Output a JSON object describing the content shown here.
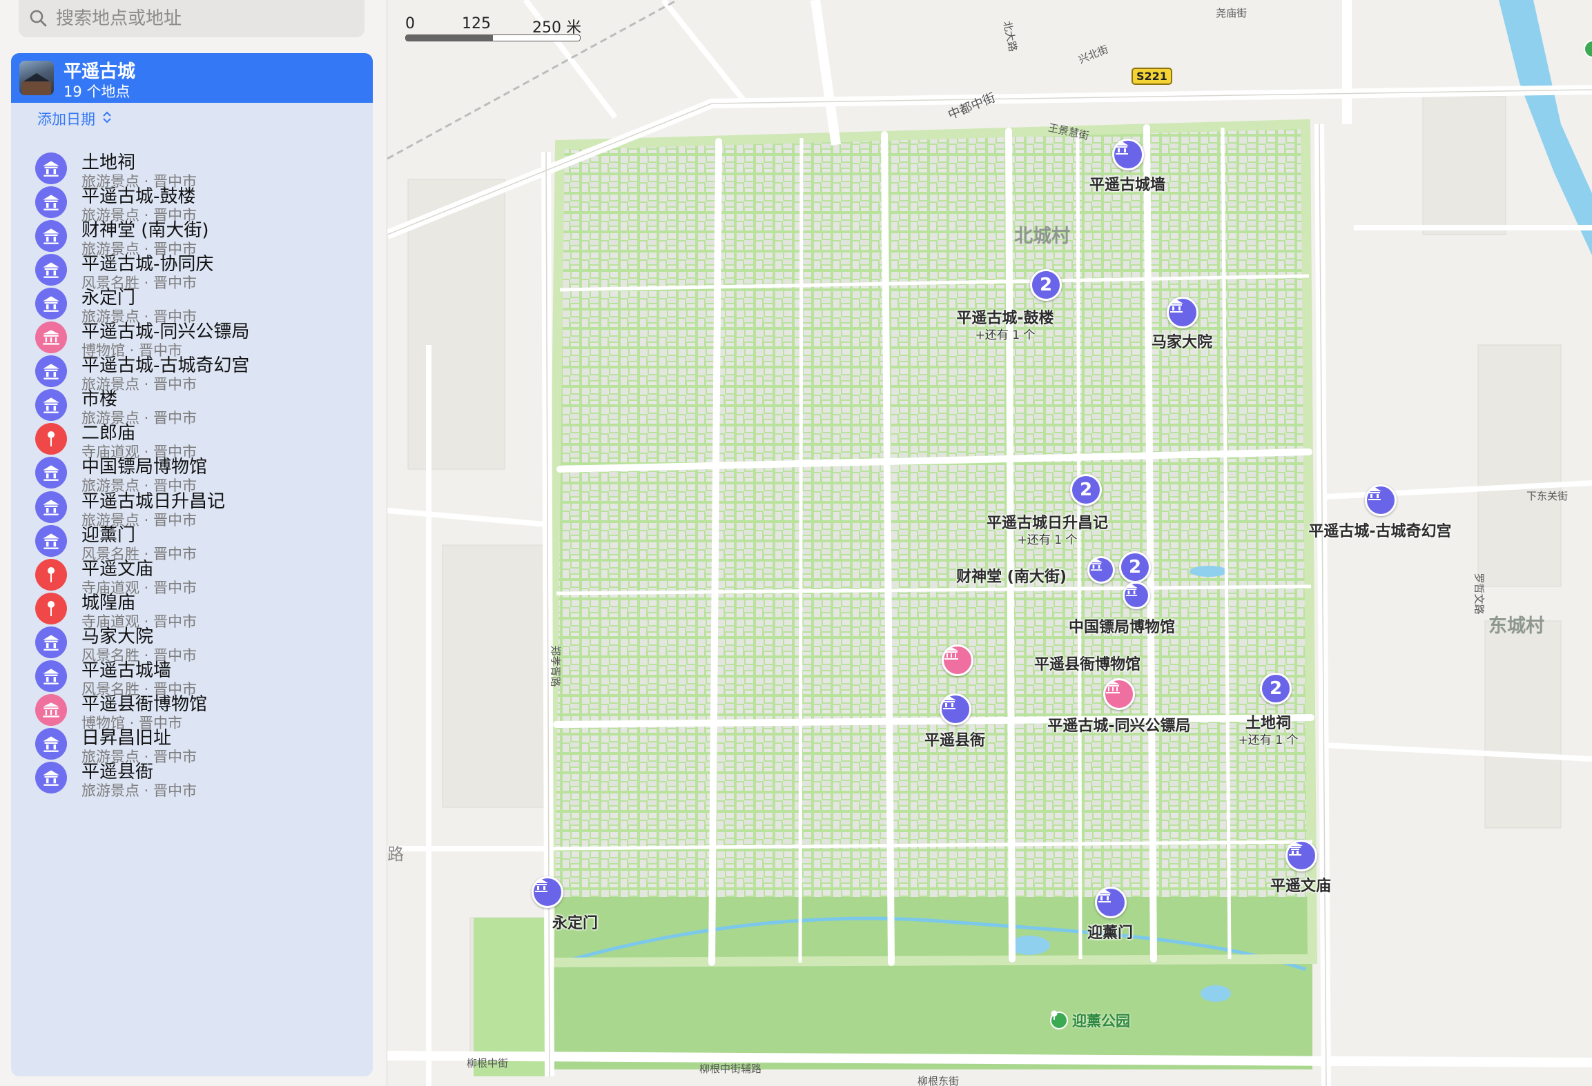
{
  "search": {
    "placeholder": "搜索地点或地址"
  },
  "guide": {
    "title": "平遥古城",
    "count": "19 个地点",
    "add_date": "添加日期",
    "places": [
      {
        "name": "土地祠",
        "category": "旅游景点",
        "city": "晋中市",
        "icon": "landmark-icon",
        "color": "purple"
      },
      {
        "name": "平遥古城-鼓楼",
        "category": "旅游景点",
        "city": "晋中市",
        "icon": "landmark-icon",
        "color": "purple"
      },
      {
        "name": "财神堂 (南大街)",
        "category": "旅游景点",
        "city": "晋中市",
        "icon": "landmark-icon",
        "color": "purple"
      },
      {
        "name": "平遥古城-协同庆",
        "category": "风景名胜",
        "city": "晋中市",
        "icon": "landmark-icon",
        "color": "purple"
      },
      {
        "name": "永定门",
        "category": "旅游景点",
        "city": "晋中市",
        "icon": "landmark-icon",
        "color": "purple"
      },
      {
        "name": "平遥古城-同兴公镖局",
        "category": "博物馆",
        "city": "晋中市",
        "icon": "museum-icon",
        "color": "pink"
      },
      {
        "name": "平遥古城-古城奇幻宫",
        "category": "旅游景点",
        "city": "晋中市",
        "icon": "landmark-icon",
        "color": "purple"
      },
      {
        "name": "市楼",
        "category": "旅游景点",
        "city": "晋中市",
        "icon": "landmark-icon",
        "color": "purple"
      },
      {
        "name": "二郎庙",
        "category": "寺庙道观",
        "city": "晋中市",
        "icon": "pin-icon",
        "color": "red"
      },
      {
        "name": "中国镖局博物馆",
        "category": "旅游景点",
        "city": "晋中市",
        "icon": "landmark-icon",
        "color": "purple"
      },
      {
        "name": "平遥古城日升昌记",
        "category": "旅游景点",
        "city": "晋中市",
        "icon": "landmark-icon",
        "color": "purple"
      },
      {
        "name": "迎薰门",
        "category": "风景名胜",
        "city": "晋中市",
        "icon": "landmark-icon",
        "color": "purple"
      },
      {
        "name": "平遥文庙",
        "category": "寺庙道观",
        "city": "晋中市",
        "icon": "pin-icon",
        "color": "red"
      },
      {
        "name": "城隍庙",
        "category": "寺庙道观",
        "city": "晋中市",
        "icon": "pin-icon",
        "color": "red"
      },
      {
        "name": "马家大院",
        "category": "风景名胜",
        "city": "晋中市",
        "icon": "landmark-icon",
        "color": "purple"
      },
      {
        "name": "平遥古城墙",
        "category": "风景名胜",
        "city": "晋中市",
        "icon": "landmark-icon",
        "color": "purple"
      },
      {
        "name": "平遥县衙博物馆",
        "category": "博物馆",
        "city": "晋中市",
        "icon": "museum-icon",
        "color": "pink"
      },
      {
        "name": "日昇昌旧址",
        "category": "旅游景点",
        "city": "晋中市",
        "icon": "landmark-icon",
        "color": "purple"
      },
      {
        "name": "平遥县衙",
        "category": "旅游景点",
        "city": "晋中市",
        "icon": "landmark-icon",
        "color": "purple"
      }
    ],
    "separator": " · "
  },
  "map": {
    "scale": {
      "zero": "0",
      "mid": "125",
      "end": "250 米"
    },
    "route_shield": "S221",
    "areas": {
      "north": "北城村",
      "east": "东城村"
    },
    "streets": {
      "xingbei": "兴北街",
      "zhongdu": "中都中街",
      "beida": "北大路",
      "yaomiao": "尧庙街",
      "wangjing": "王景慧街",
      "xiadongguan": "下东关街",
      "luozhewen": "罗哲文路",
      "zhengxiangji": "郑孝胥路",
      "liugen": "柳根中街",
      "liugen_aux": "柳根中街辅路",
      "liugen_east": "柳根东街",
      "lu": "路"
    },
    "pins": {
      "chengqiang": {
        "label": "平遥古城墙"
      },
      "gulou": {
        "label": "平遥古城-鼓楼",
        "sub": "+还有 1 个",
        "cluster": "2"
      },
      "majia": {
        "label": "马家大院"
      },
      "rishengchang": {
        "label": "平遥古城日升昌记",
        "sub": "+还有 1 个",
        "cluster": "2"
      },
      "qihuangong": {
        "label": "平遥古城-古城奇幻宫"
      },
      "caishen": {
        "label": "财神堂 (南大街)"
      },
      "caishen_cluster": {
        "cluster": "2"
      },
      "biaoju": {
        "label": "中国镖局博物馆"
      },
      "xianya_museum": {
        "label": "平遥县衙博物馆"
      },
      "tongxing": {
        "label": "平遥古城-同兴公镖局"
      },
      "tudici": {
        "label": "土地祠",
        "sub": "+还有 1 个",
        "cluster": "2"
      },
      "xianya": {
        "label": "平遥县衙"
      },
      "wenmiao": {
        "label": "平遥文庙"
      },
      "yongding": {
        "label": "永定门"
      },
      "yingxun": {
        "label": "迎薰门"
      },
      "park": {
        "label": "迎薰公园"
      }
    }
  },
  "colors": {
    "accent": "#3478f6",
    "landmark": "#6a64e8",
    "museum": "#ee6fa0",
    "temple": "#f04848",
    "park": "#a9d78e",
    "water": "#8fd0ef"
  }
}
